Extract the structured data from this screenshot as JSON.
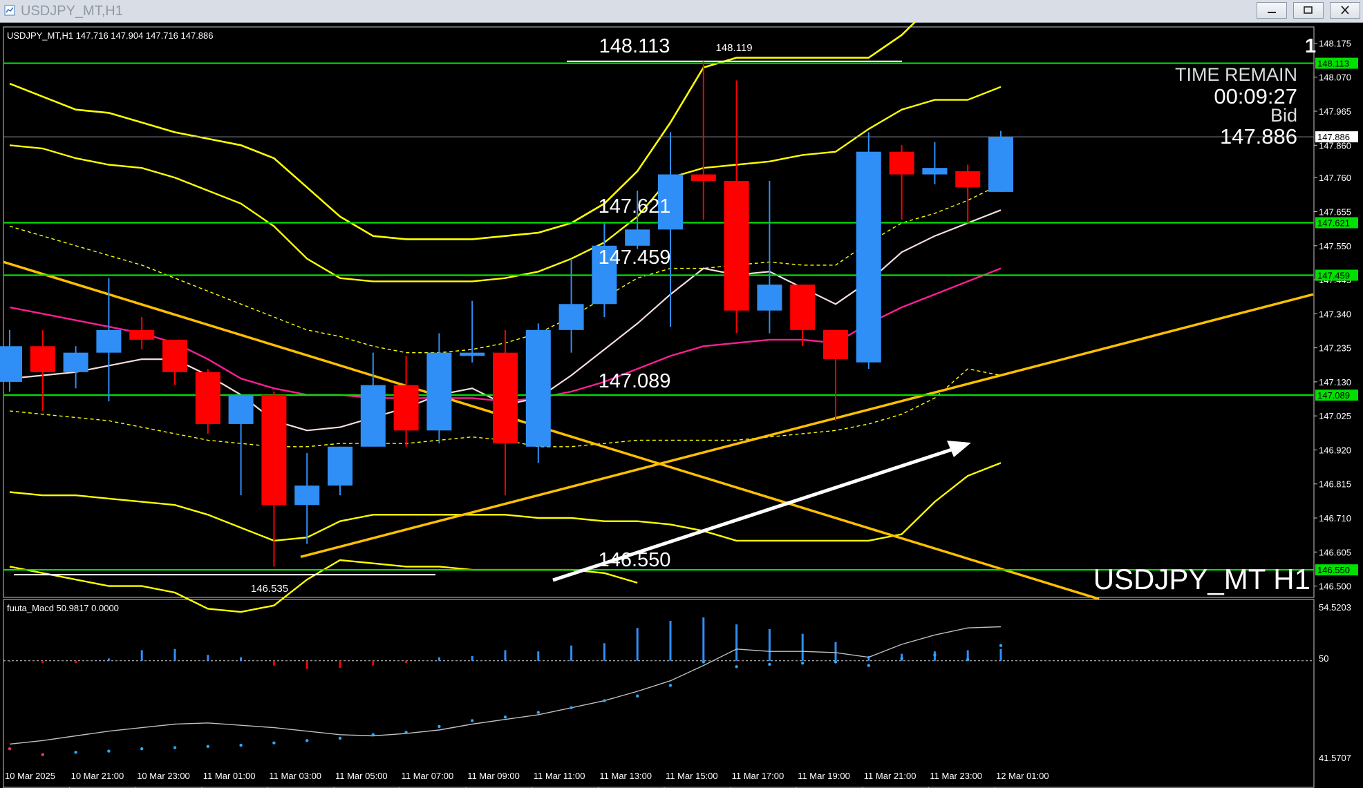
{
  "window": {
    "title": "USDJPY_MT,H1"
  },
  "main_chart": {
    "header_line": "USDJPY_MT,H1  147.716 147.904 147.716 147.886",
    "watermark": "USDJPY_MT H1",
    "time_remain_label": "TIME REMAIN",
    "time_remain_value": "00:09:27",
    "bid_label": "Bid",
    "bid_value": "147.886",
    "corner_digit": "1",
    "high_marker": "148.119",
    "low_marker": "146.535",
    "level_labels": [
      "148.113",
      "147.621",
      "147.459",
      "147.089",
      "146.550"
    ],
    "price_ticks": [
      "148.175",
      "148.070",
      "147.965",
      "147.860",
      "147.760",
      "147.655",
      "147.550",
      "147.445",
      "147.340",
      "147.235",
      "147.130",
      "147.025",
      "146.920",
      "146.815",
      "146.710",
      "146.605",
      "146.500"
    ],
    "level_tags": [
      "148.113",
      "147.886",
      "147.621",
      "147.459",
      "147.089",
      "146.550"
    ]
  },
  "indicator": {
    "header_line": "fuuta_Macd 50.9817  0.0000",
    "ticks": [
      "54.5203",
      "50",
      "41.5707"
    ]
  },
  "time_axis": [
    "10 Mar 2025",
    "10 Mar 21:00",
    "10 Mar 23:00",
    "11 Mar 01:00",
    "11 Mar 03:00",
    "11 Mar 05:00",
    "11 Mar 07:00",
    "11 Mar 09:00",
    "11 Mar 11:00",
    "11 Mar 13:00",
    "11 Mar 15:00",
    "11 Mar 17:00",
    "11 Mar 19:00",
    "11 Mar 21:00",
    "11 Mar 23:00",
    "12 Mar 01:00"
  ],
  "colors": {
    "bull": "#2f8ff7",
    "bear": "#ff0000",
    "level_line": "#00e000",
    "band": "#ffff00",
    "trendline": "#ffbf00",
    "ma_pink": "#ff1e96",
    "ma_white": "#f5dede"
  },
  "chart_data": {
    "type": "candlestick",
    "symbol": "USDJPY_MT",
    "timeframe": "H1",
    "candles": [
      {
        "o": 147.13,
        "h": 147.29,
        "l": 147.1,
        "c": 147.24
      },
      {
        "o": 147.24,
        "h": 147.29,
        "l": 147.04,
        "c": 147.16
      },
      {
        "o": 147.16,
        "h": 147.24,
        "l": 147.11,
        "c": 147.22
      },
      {
        "o": 147.22,
        "h": 147.45,
        "l": 147.07,
        "c": 147.29
      },
      {
        "o": 147.29,
        "h": 147.33,
        "l": 147.23,
        "c": 147.26
      },
      {
        "o": 147.26,
        "h": 147.26,
        "l": 147.12,
        "c": 147.16
      },
      {
        "o": 147.16,
        "h": 147.17,
        "l": 146.97,
        "c": 147.0
      },
      {
        "o": 147.0,
        "h": 147.09,
        "l": 146.78,
        "c": 147.09
      },
      {
        "o": 147.09,
        "h": 147.1,
        "l": 146.56,
        "c": 146.75
      },
      {
        "o": 146.75,
        "h": 146.91,
        "l": 146.63,
        "c": 146.81
      },
      {
        "o": 146.81,
        "h": 146.93,
        "l": 146.78,
        "c": 146.93
      },
      {
        "o": 146.93,
        "h": 147.22,
        "l": 146.93,
        "c": 147.12
      },
      {
        "o": 147.12,
        "h": 147.21,
        "l": 146.93,
        "c": 146.98
      },
      {
        "o": 146.98,
        "h": 147.28,
        "l": 146.94,
        "c": 147.22
      },
      {
        "o": 147.21,
        "h": 147.38,
        "l": 147.19,
        "c": 147.22
      },
      {
        "o": 147.22,
        "h": 147.29,
        "l": 146.78,
        "c": 146.94
      },
      {
        "o": 146.93,
        "h": 147.31,
        "l": 146.88,
        "c": 147.29
      },
      {
        "o": 147.29,
        "h": 147.51,
        "l": 147.22,
        "c": 147.37
      },
      {
        "o": 147.37,
        "h": 147.62,
        "l": 147.33,
        "c": 147.55
      },
      {
        "o": 147.55,
        "h": 147.72,
        "l": 147.54,
        "c": 147.6
      },
      {
        "o": 147.6,
        "h": 147.9,
        "l": 147.3,
        "c": 147.77
      },
      {
        "o": 147.77,
        "h": 148.119,
        "l": 147.63,
        "c": 147.75
      },
      {
        "o": 147.75,
        "h": 148.06,
        "l": 147.28,
        "c": 147.35
      },
      {
        "o": 147.35,
        "h": 147.75,
        "l": 147.28,
        "c": 147.43
      },
      {
        "o": 147.43,
        "h": 147.43,
        "l": 147.24,
        "c": 147.29
      },
      {
        "o": 147.29,
        "h": 147.29,
        "l": 147.01,
        "c": 147.2
      },
      {
        "o": 147.19,
        "h": 147.9,
        "l": 147.17,
        "c": 147.84
      },
      {
        "o": 147.84,
        "h": 147.86,
        "l": 147.63,
        "c": 147.77
      },
      {
        "o": 147.77,
        "h": 147.87,
        "l": 147.74,
        "c": 147.79
      },
      {
        "o": 147.78,
        "h": 147.8,
        "l": 147.62,
        "c": 147.73
      },
      {
        "o": 147.716,
        "h": 147.904,
        "l": 147.716,
        "c": 147.886
      }
    ],
    "horizontal_levels": [
      148.113,
      147.621,
      147.459,
      147.089,
      146.55
    ],
    "bid_line": 147.886,
    "ylim": [
      146.465,
      148.225
    ],
    "indicator": {
      "name": "fuuta_Macd",
      "baseline": 50,
      "ylim": [
        41.5707,
        54.5203
      ],
      "histogram": [
        49.9,
        49.8,
        49.8,
        50.2,
        50.9,
        51.0,
        50.5,
        50.3,
        49.6,
        49.3,
        49.4,
        49.6,
        49.8,
        50.3,
        50.4,
        50.9,
        50.8,
        51.3,
        51.5,
        52.8,
        53.4,
        53.7,
        53.1,
        52.7,
        52.3,
        51.6,
        50.4,
        50.6,
        50.8,
        50.9,
        51.0
      ],
      "signal_line": [
        42.9,
        43.2,
        43.6,
        44.0,
        44.3,
        44.6,
        44.7,
        44.5,
        44.3,
        44.0,
        43.7,
        43.6,
        43.8,
        44.1,
        44.6,
        45.0,
        45.4,
        46.0,
        46.6,
        47.4,
        48.3,
        49.6,
        51.0,
        50.8,
        50.8,
        50.7,
        50.3,
        51.4,
        52.2,
        52.8,
        52.9
      ],
      "dots": [
        42.5,
        42.0,
        42.2,
        42.3,
        42.5,
        42.6,
        42.7,
        42.8,
        43.0,
        43.2,
        43.4,
        43.7,
        43.9,
        44.4,
        44.9,
        45.2,
        45.6,
        46.0,
        46.6,
        47.0,
        47.9,
        49.9,
        49.5,
        49.7,
        49.8,
        49.9,
        49.6,
        50.2,
        50.5,
        50.1,
        51.3
      ]
    }
  }
}
